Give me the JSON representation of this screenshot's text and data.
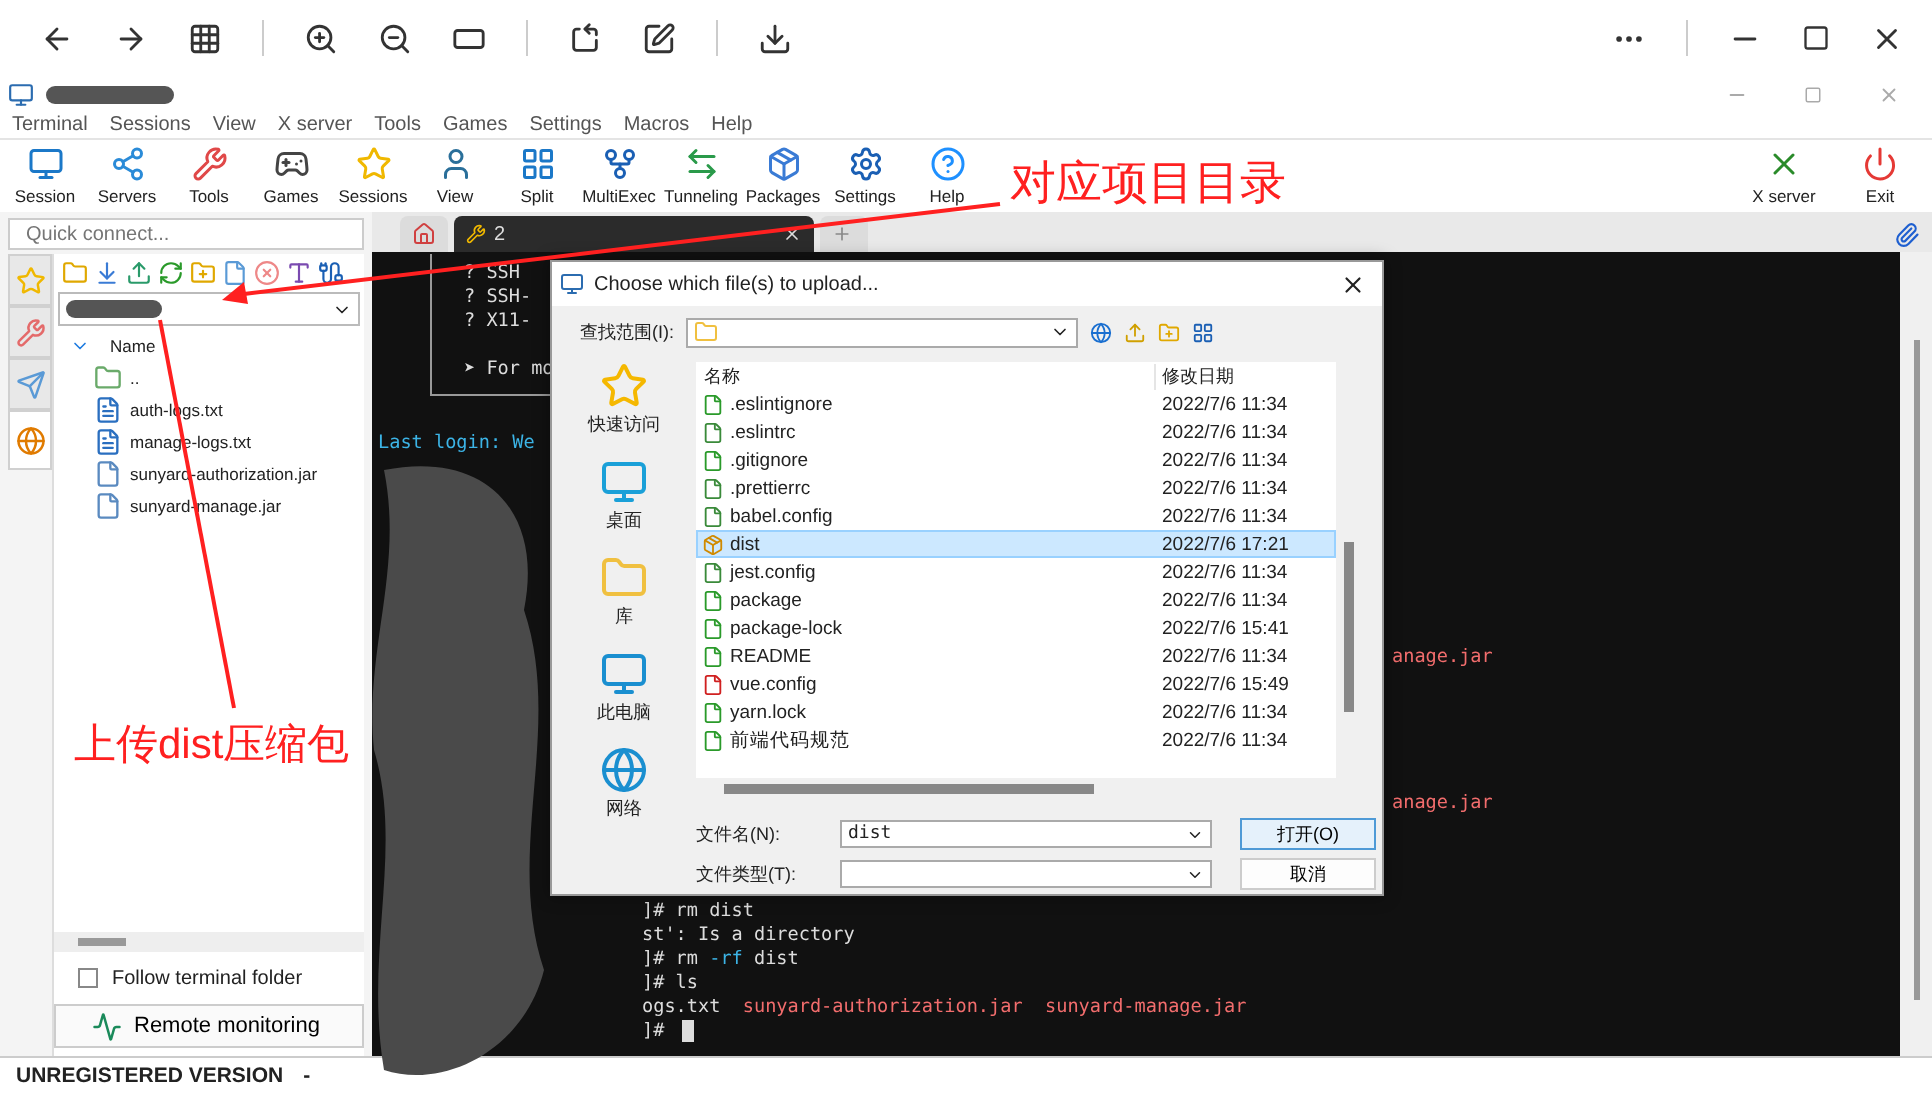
{
  "menu": [
    "Terminal",
    "Sessions",
    "View",
    "X server",
    "Tools",
    "Games",
    "Settings",
    "Macros",
    "Help"
  ],
  "toolbar": [
    {
      "label": "Session",
      "kind": "session"
    },
    {
      "label": "Servers",
      "kind": "servers"
    },
    {
      "label": "Tools",
      "kind": "tools"
    },
    {
      "label": "Games",
      "kind": "games"
    },
    {
      "label": "Sessions",
      "kind": "sessions"
    },
    {
      "label": "View",
      "kind": "view"
    },
    {
      "label": "Split",
      "kind": "split"
    },
    {
      "label": "MultiExec",
      "kind": "multiexec"
    },
    {
      "label": "Tunneling",
      "kind": "tunneling"
    },
    {
      "label": "Packages",
      "kind": "packages"
    },
    {
      "label": "Settings",
      "kind": "settings"
    },
    {
      "label": "Help",
      "kind": "help"
    }
  ],
  "toolbar_right": [
    {
      "label": "X server",
      "kind": "xserver"
    },
    {
      "label": "Exit",
      "kind": "exit"
    }
  ],
  "sidebar": {
    "quick_connect": {
      "placeholder": "Quick connect..."
    },
    "tabs": [
      {
        "kind": "star",
        "selected": false
      },
      {
        "kind": "tools",
        "selected": false
      },
      {
        "kind": "send",
        "selected": false
      },
      {
        "kind": "globe",
        "selected": true
      }
    ],
    "tree": {
      "header": "Name",
      "parent": "..",
      "files": [
        {
          "name": "auth-logs.txt",
          "kind": "text"
        },
        {
          "name": "manage-logs.txt",
          "kind": "text"
        },
        {
          "name": "sunyard-authorization.jar",
          "kind": "file"
        },
        {
          "name": "sunyard-manage.jar",
          "kind": "file"
        }
      ]
    },
    "follow_folder": {
      "label": "Follow terminal folder",
      "checked": false
    },
    "remote_monitoring": "Remote monitoring"
  },
  "terminal_tabs": [
    {
      "label": "2",
      "selected": true
    }
  ],
  "terminal": {
    "banner": [
      "? SSH",
      "? SSH-",
      "? X11-",
      "➤ For mo"
    ],
    "login": "Last login: We",
    "right_fragments": [
      "anage.jar",
      "anage.jar"
    ],
    "tail": [
      {
        "segments": [
          {
            "text": "]# rm dist"
          }
        ]
      },
      {
        "segments": [
          {
            "text": "st': Is a directory"
          }
        ]
      },
      {
        "segments": [
          {
            "text": "]# rm "
          },
          {
            "text": "-rf",
            "color": "#3cb4e6"
          },
          {
            "text": " dist"
          }
        ]
      },
      {
        "segments": [
          {
            "text": "]# ls"
          }
        ]
      },
      {
        "segments": [
          {
            "text": "ogs.txt  "
          },
          {
            "text": "sunyard-authorization.jar  sunyard-manage.jar",
            "color": "#f26d6d"
          }
        ]
      },
      {
        "segments": [
          {
            "text": "]#"
          }
        ]
      }
    ]
  },
  "status_bar": [
    "UNREGISTERED VERSION",
    "-"
  ],
  "dialog": {
    "title": "Choose which file(s) to upload...",
    "look_in_label": "查找范围(I):",
    "places": [
      {
        "label": "快速访问",
        "kind": "star"
      },
      {
        "label": "桌面",
        "kind": "desktop"
      },
      {
        "label": "库",
        "kind": "folder"
      },
      {
        "label": "此电脑",
        "kind": "pc"
      },
      {
        "label": "网络",
        "kind": "network"
      }
    ],
    "columns": [
      "名称",
      "修改日期"
    ],
    "files": [
      {
        "name": ".eslintignore",
        "date": "2022/7/6 11:34",
        "kind": "ok",
        "selected": false
      },
      {
        "name": ".eslintrc",
        "date": "2022/7/6 11:34",
        "kind": "edit",
        "selected": false
      },
      {
        "name": ".gitignore",
        "date": "2022/7/6 11:34",
        "kind": "ok",
        "selected": false
      },
      {
        "name": ".prettierrc",
        "date": "2022/7/6 11:34",
        "kind": "edit",
        "selected": false
      },
      {
        "name": "babel.config",
        "date": "2022/7/6 11:34",
        "kind": "edit",
        "selected": false
      },
      {
        "name": "dist",
        "date": "2022/7/6 17:21",
        "kind": "archive",
        "selected": true
      },
      {
        "name": "jest.config",
        "date": "2022/7/6 11:34",
        "kind": "edit",
        "selected": false
      },
      {
        "name": "package",
        "date": "2022/7/6 11:34",
        "kind": "ok",
        "selected": false
      },
      {
        "name": "package-lock",
        "date": "2022/7/6 15:41",
        "kind": "ok",
        "selected": false
      },
      {
        "name": "README",
        "date": "2022/7/6 11:34",
        "kind": "ok",
        "selected": false
      },
      {
        "name": "vue.config",
        "date": "2022/7/6 15:49",
        "kind": "error",
        "selected": false
      },
      {
        "name": "yarn.lock",
        "date": "2022/7/6 11:34",
        "kind": "ok",
        "selected": false
      },
      {
        "name": "前端代码规范",
        "date": "2022/7/6 11:34",
        "kind": "ok",
        "selected": false
      }
    ],
    "filename_label": "文件名(N):",
    "filename_value": "dist",
    "filetype_label": "文件类型(T):",
    "buttons": [
      "打开(O)",
      "取消"
    ]
  },
  "annotations": [
    {
      "text": "对应项目目录",
      "kind": "top"
    },
    {
      "text": "上传dist压缩包",
      "kind": "bottom"
    }
  ]
}
